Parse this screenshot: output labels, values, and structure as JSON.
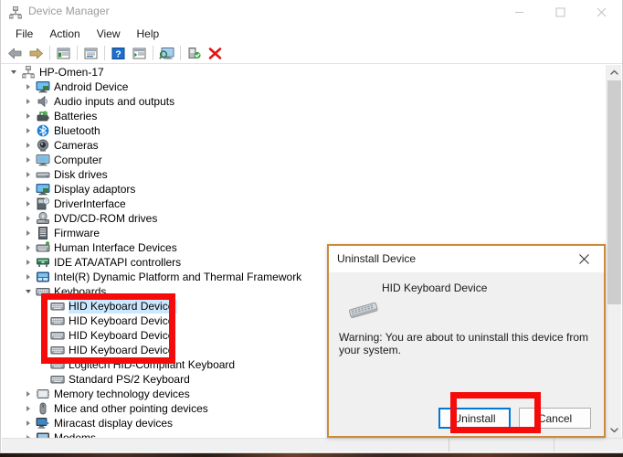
{
  "window": {
    "title": "Device Manager",
    "icon": "device-manager-icon",
    "caption_buttons": [
      {
        "name": "minimize-button",
        "glyph": "minimize-icon"
      },
      {
        "name": "maximize-button",
        "glyph": "maximize-icon"
      },
      {
        "name": "close-button",
        "glyph": "close-icon"
      }
    ]
  },
  "menubar": {
    "items": [
      {
        "label": "File"
      },
      {
        "label": "Action"
      },
      {
        "label": "View"
      },
      {
        "label": "Help"
      }
    ]
  },
  "toolbar": {
    "buttons": [
      {
        "name": "back-button",
        "icon": "arrow-left-icon"
      },
      {
        "name": "forward-button",
        "icon": "arrow-right-icon"
      },
      {
        "name": "separator-1",
        "icon": "separator"
      },
      {
        "name": "properties-button",
        "icon": "properties-icon"
      },
      {
        "name": "separator-2",
        "icon": "separator"
      },
      {
        "name": "update-driver-button",
        "icon": "update-driver-icon"
      },
      {
        "name": "separator-3",
        "icon": "separator"
      },
      {
        "name": "help-button",
        "icon": "question-mark-icon"
      },
      {
        "name": "show-hidden-button",
        "icon": "show-hidden-icon"
      },
      {
        "name": "separator-4",
        "icon": "separator"
      },
      {
        "name": "scan-hardware-button",
        "icon": "monitor-scan-icon"
      },
      {
        "name": "separator-5",
        "icon": "separator"
      },
      {
        "name": "enable-device-button",
        "icon": "enable-device-icon"
      },
      {
        "name": "uninstall-device-button",
        "icon": "red-x-icon"
      }
    ]
  },
  "tree": {
    "root": {
      "label": "HP-Omen-17",
      "icon": "computer-root-icon",
      "expanded": true
    },
    "items": [
      {
        "label": "Android Device",
        "icon": "display-adapter-icon",
        "indent": 1,
        "expandable": true,
        "expanded": false,
        "selected": false
      },
      {
        "label": "Audio inputs and outputs",
        "icon": "speaker-icon",
        "indent": 1,
        "expandable": true,
        "expanded": false,
        "selected": false
      },
      {
        "label": "Batteries",
        "icon": "battery-icon",
        "indent": 1,
        "expandable": true,
        "expanded": false,
        "selected": false
      },
      {
        "label": "Bluetooth",
        "icon": "bluetooth-icon",
        "indent": 1,
        "expandable": true,
        "expanded": false,
        "selected": false
      },
      {
        "label": "Cameras",
        "icon": "camera-icon",
        "indent": 1,
        "expandable": true,
        "expanded": false,
        "selected": false
      },
      {
        "label": "Computer",
        "icon": "computer-icon",
        "indent": 1,
        "expandable": true,
        "expanded": false,
        "selected": false
      },
      {
        "label": "Disk drives",
        "icon": "disk-drive-icon",
        "indent": 1,
        "expandable": true,
        "expanded": false,
        "selected": false
      },
      {
        "label": "Display adaptors",
        "icon": "display-adapter-icon",
        "indent": 1,
        "expandable": true,
        "expanded": false,
        "selected": false
      },
      {
        "label": "DriverInterface",
        "icon": "driver-interface-icon",
        "indent": 1,
        "expandable": true,
        "expanded": false,
        "selected": false
      },
      {
        "label": "DVD/CD-ROM drives",
        "icon": "dvd-drive-icon",
        "indent": 1,
        "expandable": true,
        "expanded": false,
        "selected": false
      },
      {
        "label": "Firmware",
        "icon": "firmware-icon",
        "indent": 1,
        "expandable": true,
        "expanded": false,
        "selected": false
      },
      {
        "label": "Human Interface Devices",
        "icon": "hid-icon",
        "indent": 1,
        "expandable": true,
        "expanded": false,
        "selected": false
      },
      {
        "label": "IDE ATA/ATAPI controllers",
        "icon": "ide-controller-icon",
        "indent": 1,
        "expandable": true,
        "expanded": false,
        "selected": false
      },
      {
        "label": "Intel(R) Dynamic Platform and Thermal Framework",
        "icon": "thermal-framework-icon",
        "indent": 1,
        "expandable": true,
        "expanded": false,
        "selected": false
      },
      {
        "label": "Keyboards",
        "icon": "keyboard-category-icon",
        "indent": 1,
        "expandable": true,
        "expanded": true,
        "selected": false
      },
      {
        "label": "HID Keyboard Device",
        "icon": "keyboard-icon",
        "indent": 2,
        "expandable": false,
        "expanded": false,
        "selected": true
      },
      {
        "label": "HID Keyboard Device",
        "icon": "keyboard-icon",
        "indent": 2,
        "expandable": false,
        "expanded": false,
        "selected": false
      },
      {
        "label": "HID Keyboard Device",
        "icon": "keyboard-icon",
        "indent": 2,
        "expandable": false,
        "expanded": false,
        "selected": false
      },
      {
        "label": "HID Keyboard Device",
        "icon": "keyboard-icon",
        "indent": 2,
        "expandable": false,
        "expanded": false,
        "selected": false
      },
      {
        "label": "Logitech HID-Compliant Keyboard",
        "icon": "keyboard-icon",
        "indent": 2,
        "expandable": false,
        "expanded": false,
        "selected": false
      },
      {
        "label": "Standard PS/2 Keyboard",
        "icon": "keyboard-icon",
        "indent": 2,
        "expandable": false,
        "expanded": false,
        "selected": false
      },
      {
        "label": "Memory technology devices",
        "icon": "memory-device-icon",
        "indent": 1,
        "expandable": true,
        "expanded": false,
        "selected": false
      },
      {
        "label": "Mice and other pointing devices",
        "icon": "mouse-icon",
        "indent": 1,
        "expandable": true,
        "expanded": false,
        "selected": false
      },
      {
        "label": "Miracast display devices",
        "icon": "miracast-icon",
        "indent": 1,
        "expandable": true,
        "expanded": false,
        "selected": false
      },
      {
        "label": "Modems",
        "icon": "modem-icon",
        "indent": 1,
        "expandable": true,
        "expanded": false,
        "selected": false
      }
    ]
  },
  "dialog": {
    "title": "Uninstall Device",
    "close_icon": "close-icon",
    "device_icon": "keyboard-large-icon",
    "device_name": "HID Keyboard Device",
    "warning": "Warning: You are about to uninstall this device from your system.",
    "buttons": [
      {
        "label": "Uninstall",
        "name": "uninstall-button",
        "default": true
      },
      {
        "label": "Cancel",
        "name": "cancel-button",
        "default": false
      }
    ]
  },
  "annotations": {
    "color": "#f60b0b",
    "regions": [
      {
        "name": "hid-keyboard-devices-highlight"
      },
      {
        "name": "uninstall-button-highlight"
      }
    ]
  },
  "scrollbar": {
    "up_arrow": "chevron-up-icon",
    "down_arrow": "chevron-down-icon"
  }
}
